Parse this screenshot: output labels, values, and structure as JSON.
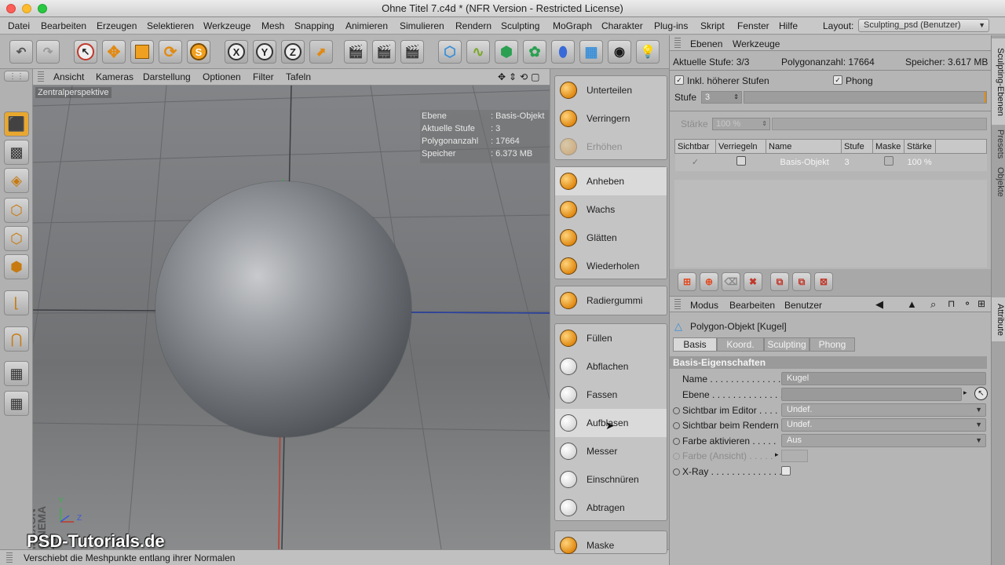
{
  "window": {
    "title": "Ohne Titel 7.c4d * (NFR Version - Restricted License)"
  },
  "menu": [
    "Datei",
    "Bearbeiten",
    "Erzeugen",
    "Selektieren",
    "Werkzeuge",
    "Mesh",
    "Snapping",
    "Animieren",
    "Simulieren",
    "Rendern",
    "Sculpting",
    "MoGraph",
    "Charakter",
    "Plug-ins",
    "Skript",
    "Fenster",
    "Hilfe"
  ],
  "layout": {
    "label": "Layout:",
    "value": "Sculpting_psd (Benutzer)"
  },
  "toolbar": {
    "x_axis": "X",
    "y_axis": "Y",
    "z_axis": "Z"
  },
  "viewport": {
    "menu": [
      "Ansicht",
      "Kameras",
      "Darstellung",
      "Optionen",
      "Filter",
      "Tafeln"
    ],
    "camera_label": "Zentralperspektive",
    "hud": [
      {
        "key": "Ebene",
        "value": ": Basis-Objekt"
      },
      {
        "key": "Aktuelle Stufe",
        "value": ": 3"
      },
      {
        "key": "Polygonanzahl",
        "value": ": 17664"
      },
      {
        "key": "Speicher",
        "value": ": 6.373 MB"
      }
    ],
    "watermark": "MAXON CINEMA 4D",
    "axis_y": "Y",
    "axis_z": "Z"
  },
  "brand": "PSD-Tutorials.de",
  "status": "Verschiebt die Meshpunkte entlang ihrer Normalen",
  "brushes": {
    "group1": [
      "Unterteilen",
      "Verringern",
      "Erhöhen"
    ],
    "group2": [
      "Anheben",
      "Wachs",
      "Glätten",
      "Wiederholen"
    ],
    "group3": [
      "Radiergummi"
    ],
    "group4": [
      "Füllen",
      "Abflachen",
      "Fassen",
      "Aufblasen",
      "Messer",
      "Einschnüren",
      "Abtragen"
    ],
    "group5": [
      "Maske"
    ]
  },
  "sculpt_layers": {
    "tabs": [
      "Ebenen",
      "Werkzeuge"
    ],
    "current_level": "Aktuelle Stufe: 3/3",
    "polycount": "Polygonanzahl: 17664",
    "memory": "Speicher: 3.617 MB",
    "incl_higher": "Inkl. höherer Stufen",
    "phong": "Phong",
    "level_label": "Stufe",
    "level_value": "3",
    "strength_label": "Stärke",
    "strength_value": "100 %",
    "columns": [
      "Sichtbar",
      "Verriegeln",
      "Name",
      "Stufe",
      "Maske",
      "Stärke"
    ],
    "rows": [
      {
        "name": "Basis-Objekt",
        "level": "3",
        "strength": "100 %"
      }
    ]
  },
  "attributes": {
    "menu": [
      "Modus",
      "Bearbeiten",
      "Benutzer"
    ],
    "object": "Polygon-Objekt [Kugel]",
    "tabs": [
      "Basis",
      "Koord.",
      "Sculpting",
      "Phong"
    ],
    "section": "Basis-Eigenschaften",
    "props": [
      {
        "label": "Name . . . . . . . . . . . . . .",
        "value": "Kugel"
      },
      {
        "label": "Ebene . . . . . . . . . . . . . .",
        "value": ""
      },
      {
        "label": "Sichtbar im Editor . . . .",
        "value": "Undef."
      },
      {
        "label": "Sichtbar beim Rendern",
        "value": "Undef."
      },
      {
        "label": "Farbe aktivieren . . . . .",
        "value": "Aus"
      },
      {
        "label": "Farbe (Ansicht) . . . . .",
        "value": ""
      },
      {
        "label": "X-Ray . . . . . . . . . . . . . .",
        "value": ""
      }
    ]
  },
  "side_tabs": [
    "Sculpting-Ebenen",
    "Presets",
    "Objekte",
    "Attribute"
  ]
}
